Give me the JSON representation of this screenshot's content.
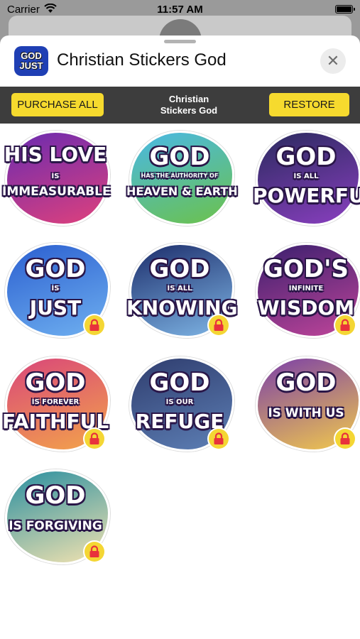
{
  "status_bar": {
    "carrier": "Carrier",
    "time": "11:57 AM"
  },
  "header": {
    "app_icon_lines": [
      "GOD",
      "JUST"
    ],
    "title": "Christian Stickers God"
  },
  "toolbar": {
    "purchase_label": "PURCHASE ALL",
    "center_title_lines": [
      "Christian",
      "Stickers God"
    ],
    "restore_label": "RESTORE"
  },
  "stickers": [
    {
      "lines": [
        "HIS LOVE",
        "IS",
        "IMMEASURABLE"
      ],
      "locked": false,
      "bg": "#6a2bb0",
      "bg2": "#e0417c"
    },
    {
      "lines": [
        "GOD",
        "HAS THE AUTHORITY OF",
        "HEAVEN & EARTH"
      ],
      "locked": false,
      "bg": "#49b8e6",
      "bg2": "#6cc24a"
    },
    {
      "lines": [
        "GOD",
        "IS ALL",
        "POWERFUL"
      ],
      "locked": false,
      "bg": "#2a2a5e",
      "bg2": "#8a3fc0"
    },
    {
      "lines": [
        "GOD",
        "IS",
        "JUST"
      ],
      "locked": true,
      "bg": "#2b5fd0",
      "bg2": "#6fb0f0"
    },
    {
      "lines": [
        "GOD",
        "IS ALL",
        "KNOWING"
      ],
      "locked": true,
      "bg": "#1c2d6b",
      "bg2": "#7fb6e6"
    },
    {
      "lines": [
        "GOD'S",
        "INFINITE",
        "WISDOM"
      ],
      "locked": true,
      "bg": "#3a1f6e",
      "bg2": "#c0459a"
    },
    {
      "lines": [
        "GOD",
        "IS FOREVER",
        "FAITHFUL"
      ],
      "locked": true,
      "bg": "#d9467a",
      "bg2": "#f3a44a"
    },
    {
      "lines": [
        "GOD",
        "IS OUR",
        "REFUGE"
      ],
      "locked": true,
      "bg": "#2f3d6e",
      "bg2": "#5d7fb5"
    },
    {
      "lines": [
        "GOD",
        "IS WITH US",
        ""
      ],
      "locked": true,
      "bg": "#7b3fa8",
      "bg2": "#f2c94c"
    },
    {
      "lines": [
        "GOD",
        "IS FORGIVING",
        ""
      ],
      "locked": true,
      "bg": "#2a8fa0",
      "bg2": "#f3e3b0"
    }
  ]
}
